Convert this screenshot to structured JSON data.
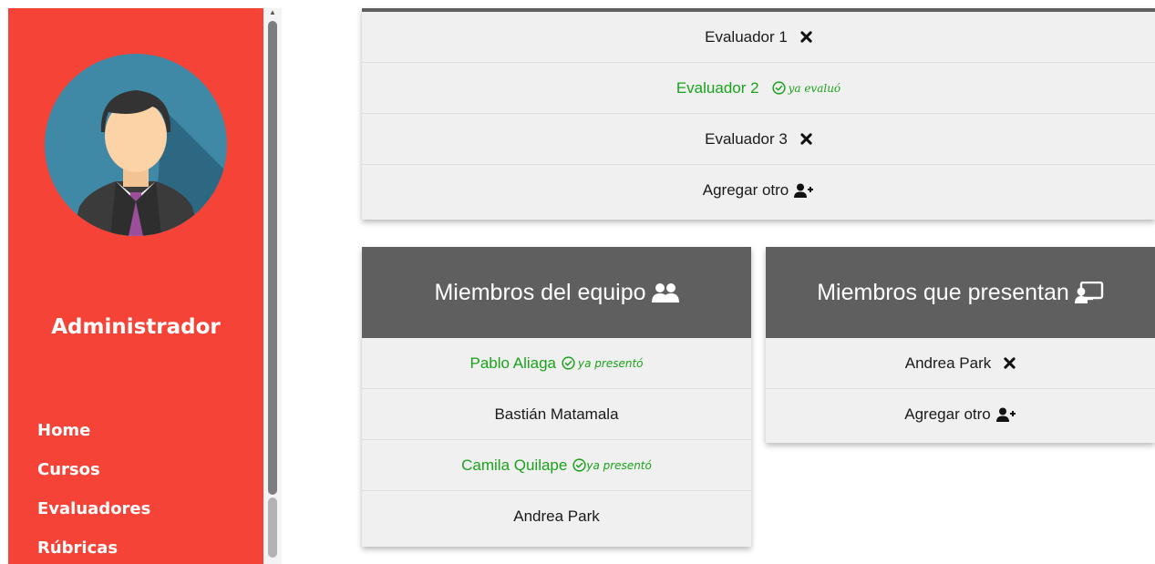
{
  "sidebar": {
    "role": "Administrador",
    "nav": [
      {
        "label": "Home"
      },
      {
        "label": "Cursos"
      },
      {
        "label": "Evaluadores"
      },
      {
        "label": "Rúbricas"
      }
    ]
  },
  "evaluators": {
    "items": [
      {
        "name": "Evaluador 1",
        "status": "remove"
      },
      {
        "name": "Evaluador 2",
        "status": "done",
        "note": "ya evaluó"
      },
      {
        "name": "Evaluador 3",
        "status": "remove"
      }
    ],
    "add_label": "Agregar otro"
  },
  "team": {
    "title": "Miembros del equipo",
    "members": [
      {
        "name": "Pablo Aliaga",
        "note": "ya presentó"
      },
      {
        "name": "Bastián Matamala"
      },
      {
        "name": "Camila Quilape",
        "note": "ya presentó"
      },
      {
        "name": "Andrea Park"
      }
    ]
  },
  "presenters": {
    "title": "Miembros que presentan",
    "items": [
      {
        "name": "Andrea Park"
      }
    ],
    "add_label": "Agregar otro"
  },
  "colors": {
    "sidebar": "#f54437",
    "done_green": "#1aa31a",
    "header_gray": "#5f5f5f"
  }
}
